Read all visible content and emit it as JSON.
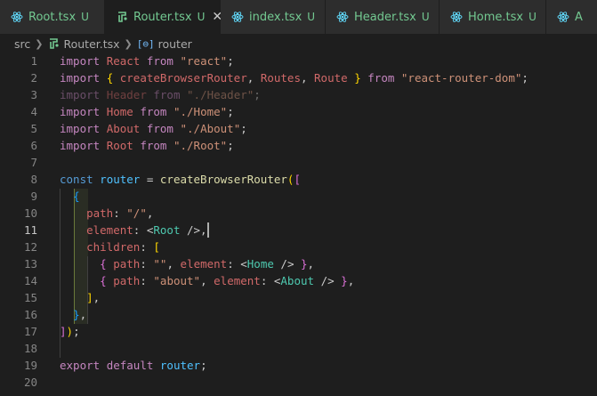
{
  "tabs": [
    {
      "name": "Root.tsx",
      "status": "U",
      "icon": "react-icon",
      "active": false
    },
    {
      "name": "Router.tsx",
      "status": "U",
      "icon": "react-router-icon",
      "active": true,
      "close": "✕"
    },
    {
      "name": "index.tsx",
      "status": "U",
      "icon": "react-icon",
      "active": false
    },
    {
      "name": "Header.tsx",
      "status": "U",
      "icon": "react-icon",
      "active": false
    },
    {
      "name": "Home.tsx",
      "status": "U",
      "icon": "react-icon",
      "active": false
    },
    {
      "name": "A",
      "status": "",
      "icon": "react-icon",
      "active": false
    }
  ],
  "breadcrumb": {
    "folder": "src",
    "file": "Router.tsx",
    "symbol": "router",
    "symbol_icon": "[⊖]"
  },
  "editor": {
    "current_line": 11,
    "line_numbers": [
      "1",
      "2",
      "3",
      "4",
      "5",
      "6",
      "7",
      "8",
      "9",
      "10",
      "11",
      "12",
      "13",
      "14",
      "15",
      "16",
      "17",
      "18",
      "19",
      "20"
    ],
    "lines": [
      [
        [
          "kw2",
          "import"
        ],
        [
          "pu",
          " "
        ],
        [
          "id",
          "React"
        ],
        [
          "pu",
          " "
        ],
        [
          "kw2",
          "from"
        ],
        [
          "pu",
          " "
        ],
        [
          "str",
          "\"react\""
        ],
        [
          "pu",
          ";"
        ]
      ],
      [
        [
          "kw2",
          "import"
        ],
        [
          "pu",
          " "
        ],
        [
          "br1",
          "{"
        ],
        [
          "pu",
          " "
        ],
        [
          "id",
          "createBrowserRouter"
        ],
        [
          "pu",
          ", "
        ],
        [
          "id",
          "Routes"
        ],
        [
          "pu",
          ", "
        ],
        [
          "id",
          "Route"
        ],
        [
          "pu",
          " "
        ],
        [
          "br1",
          "}"
        ],
        [
          "pu",
          " "
        ],
        [
          "kw2",
          "from"
        ],
        [
          "pu",
          " "
        ],
        [
          "str",
          "\"react-router-dom\""
        ],
        [
          "pu",
          ";"
        ]
      ],
      [
        [
          "kw2 dim",
          "import"
        ],
        [
          "pu dim",
          " "
        ],
        [
          "id dim",
          "Header"
        ],
        [
          "pu dim",
          " "
        ],
        [
          "kw2 dim",
          "from"
        ],
        [
          "pu dim",
          " "
        ],
        [
          "str dim",
          "\"./Header\""
        ],
        [
          "pu dim",
          ";"
        ]
      ],
      [
        [
          "kw2",
          "import"
        ],
        [
          "pu",
          " "
        ],
        [
          "id",
          "Home"
        ],
        [
          "pu",
          " "
        ],
        [
          "kw2",
          "from"
        ],
        [
          "pu",
          " "
        ],
        [
          "str",
          "\"./Home\""
        ],
        [
          "pu",
          ";"
        ]
      ],
      [
        [
          "kw2",
          "import"
        ],
        [
          "pu",
          " "
        ],
        [
          "id",
          "About"
        ],
        [
          "pu",
          " "
        ],
        [
          "kw2",
          "from"
        ],
        [
          "pu",
          " "
        ],
        [
          "str",
          "\"./About\""
        ],
        [
          "pu",
          ";"
        ]
      ],
      [
        [
          "kw2",
          "import"
        ],
        [
          "pu",
          " "
        ],
        [
          "id",
          "Root"
        ],
        [
          "pu",
          " "
        ],
        [
          "kw2",
          "from"
        ],
        [
          "pu",
          " "
        ],
        [
          "str",
          "\"./Root\""
        ],
        [
          "pu",
          ";"
        ]
      ],
      [],
      [
        [
          "kw",
          "const"
        ],
        [
          "pu",
          " "
        ],
        [
          "var",
          "router"
        ],
        [
          "pu",
          " = "
        ],
        [
          "fn",
          "createBrowserRouter"
        ],
        [
          "br1",
          "("
        ],
        [
          "br2",
          "["
        ]
      ],
      [
        [
          "pu",
          "  "
        ],
        [
          "br3",
          "{"
        ]
      ],
      [
        [
          "pu",
          "    "
        ],
        [
          "prop2",
          "path"
        ],
        [
          "pu",
          ": "
        ],
        [
          "str",
          "\"/\""
        ],
        [
          "pu",
          ","
        ]
      ],
      [
        [
          "pu",
          "    "
        ],
        [
          "prop2",
          "element"
        ],
        [
          "pu",
          ": <"
        ],
        [
          "tag",
          "Root"
        ],
        [
          "pu",
          " />,"
        ],
        [
          "cursor",
          ""
        ]
      ],
      [
        [
          "pu",
          "    "
        ],
        [
          "prop2",
          "children"
        ],
        [
          "pu",
          ": "
        ],
        [
          "br1",
          "["
        ]
      ],
      [
        [
          "pu",
          "      "
        ],
        [
          "br2",
          "{"
        ],
        [
          "pu",
          " "
        ],
        [
          "prop2",
          "path"
        ],
        [
          "pu",
          ": "
        ],
        [
          "str",
          "\"\""
        ],
        [
          "pu",
          ", "
        ],
        [
          "prop2",
          "element"
        ],
        [
          "pu",
          ": <"
        ],
        [
          "tag",
          "Home"
        ],
        [
          "pu",
          " /> "
        ],
        [
          "br2",
          "}"
        ],
        [
          "pu",
          ","
        ]
      ],
      [
        [
          "pu",
          "      "
        ],
        [
          "br2",
          "{"
        ],
        [
          "pu",
          " "
        ],
        [
          "prop2",
          "path"
        ],
        [
          "pu",
          ": "
        ],
        [
          "str",
          "\"about\""
        ],
        [
          "pu",
          ", "
        ],
        [
          "prop2",
          "element"
        ],
        [
          "pu",
          ": <"
        ],
        [
          "tag",
          "About"
        ],
        [
          "pu",
          " /> "
        ],
        [
          "br2",
          "}"
        ],
        [
          "pu",
          ","
        ]
      ],
      [
        [
          "pu",
          "    "
        ],
        [
          "br1",
          "]"
        ],
        [
          "pu",
          ","
        ]
      ],
      [
        [
          "pu",
          "  "
        ],
        [
          "br3",
          "}"
        ],
        [
          "pu",
          ","
        ]
      ],
      [
        [
          "br2",
          "]"
        ],
        [
          "br1",
          ")"
        ],
        [
          "pu",
          ";"
        ]
      ],
      [],
      [
        [
          "kw2",
          "export"
        ],
        [
          "pu",
          " "
        ],
        [
          "kw2",
          "default"
        ],
        [
          "pu",
          " "
        ],
        [
          "var",
          "router"
        ],
        [
          "pu",
          ";"
        ]
      ],
      []
    ]
  }
}
